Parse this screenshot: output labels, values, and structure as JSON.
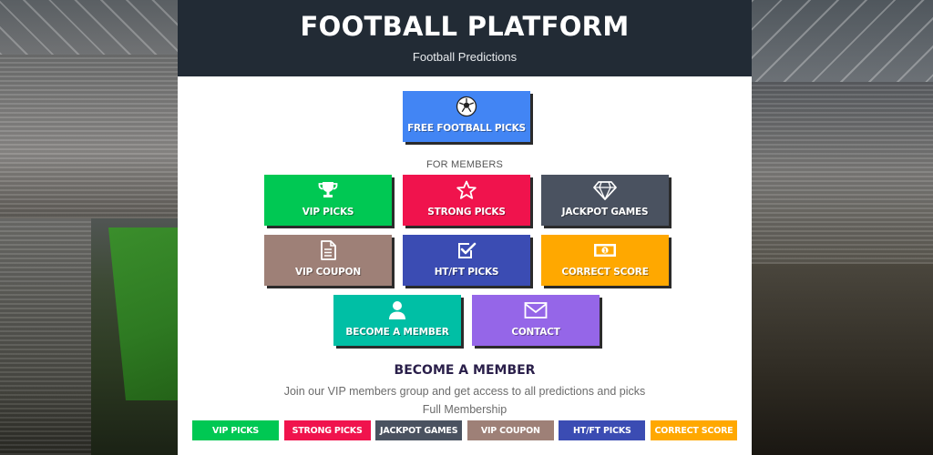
{
  "header": {
    "title": "FOOTBALL PLATFORM",
    "subtitle": "Football Predictions"
  },
  "free_pick": {
    "label": "FREE FOOTBALL PICKS",
    "icon": "soccer-ball-icon",
    "color": "#4285f4"
  },
  "members_label": "FOR MEMBERS",
  "tiles": [
    {
      "label": "VIP PICKS",
      "icon": "trophy-icon",
      "color": "#00c853"
    },
    {
      "label": "STRONG PICKS",
      "icon": "star-icon",
      "color": "#f0134d"
    },
    {
      "label": "JACKPOT GAMES",
      "icon": "diamond-icon",
      "color": "#4a5260"
    },
    {
      "label": "VIP COUPON",
      "icon": "document-icon",
      "color": "#9e8077"
    },
    {
      "label": "HT/FT PICKS",
      "icon": "checkbox-icon",
      "color": "#3b4cb3"
    },
    {
      "label": "CORRECT SCORE",
      "icon": "money-icon",
      "color": "#ffa800"
    },
    {
      "label": "BECOME A MEMBER",
      "icon": "user-icon",
      "color": "#00bfa5"
    },
    {
      "label": "CONTACT",
      "icon": "envelope-icon",
      "color": "#9566e8"
    }
  ],
  "become": {
    "heading": "BECOME A MEMBER",
    "text": "Join our VIP members group and get access to all predictions and picks",
    "membership": "Full Membership"
  },
  "chips": [
    {
      "label": "VIP PICKS",
      "color": "#00c853"
    },
    {
      "label": "STRONG PICKS",
      "color": "#f0134d"
    },
    {
      "label": "JACKPOT GAMES",
      "color": "#4a5260"
    },
    {
      "label": "VIP COUPON",
      "color": "#9e8077"
    },
    {
      "label": "HT/FT PICKS",
      "color": "#3b4cb3"
    },
    {
      "label": "CORRECT SCORE",
      "color": "#ffa800"
    }
  ]
}
